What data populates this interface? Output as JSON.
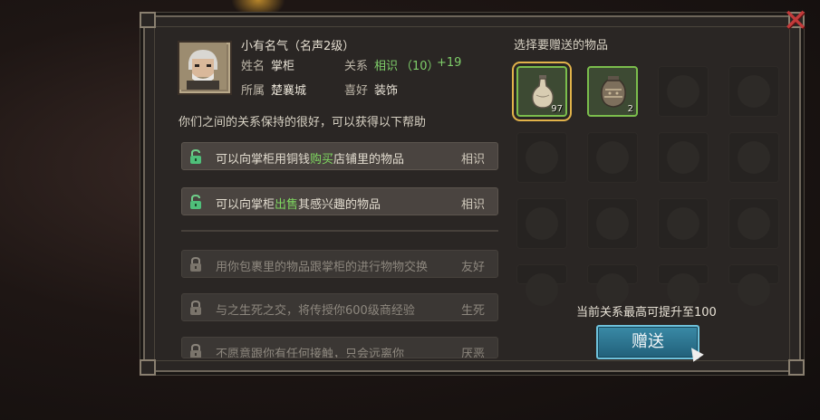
{
  "close_label": "✕",
  "npc": {
    "title": "小有名气（名声2级）",
    "name_label": "姓名",
    "name_value": "掌柜",
    "relation_label": "关系",
    "relation_value": "相识",
    "relation_points": "（10）",
    "relation_bonus": "+19",
    "affiliation_label": "所属",
    "affiliation_value": "楚襄城",
    "hobby_label": "喜好",
    "hobby_value": "装饰"
  },
  "help": {
    "description": "你们之间的关系保持的很好，可以获得以下帮助",
    "unlocked": [
      {
        "pre": "可以向掌柜用铜钱",
        "highlight": "购买",
        "post": "店铺里的物品",
        "tag": "相识"
      },
      {
        "pre": "可以向掌柜",
        "highlight": "出售",
        "post": "其感兴趣的物品",
        "tag": "相识"
      }
    ],
    "locked": [
      {
        "text": "用你包裹里的物品跟掌柜的进行物物交换",
        "tag": "友好"
      },
      {
        "text": "与之生死之交，将传授你600级商经验",
        "tag": "生死"
      },
      {
        "text": "不愿意跟你有任何接触，只会远离你",
        "tag": "厌恶"
      }
    ]
  },
  "gift": {
    "title": "选择要赠送的物品",
    "items": [
      {
        "icon": "vase-icon",
        "count": "97",
        "selected": true
      },
      {
        "icon": "jar-icon",
        "count": "2",
        "selected": false
      }
    ],
    "status_text": "当前关系最高可提升至100",
    "give_button": "赠送"
  },
  "colors": {
    "accent_green": "#7fcf6a",
    "selected_gold": "#e2b34a",
    "button_blue": "#2f7a96",
    "close_red": "#c23a3a"
  }
}
